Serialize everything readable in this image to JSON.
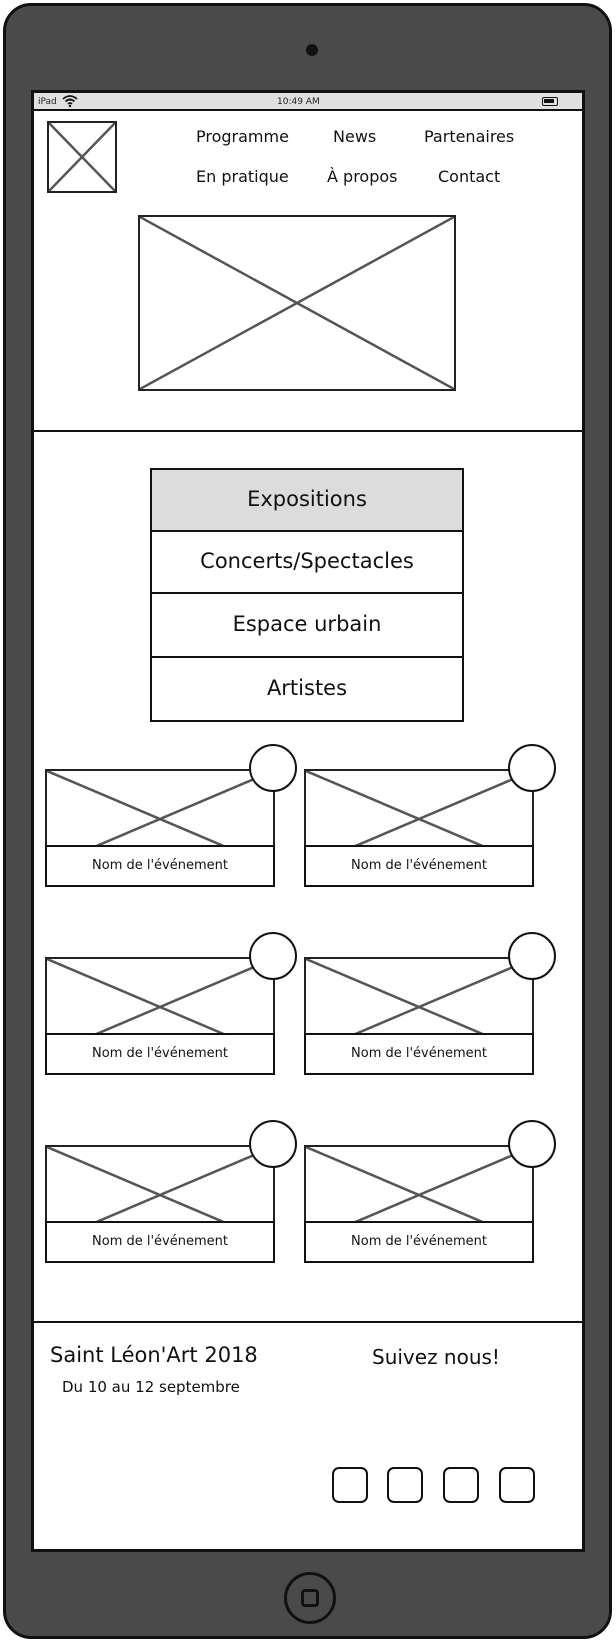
{
  "status_bar": {
    "device": "iPad",
    "time": "10:49 AM",
    "wifi_icon": "wifi-icon",
    "battery_icon": "battery-icon"
  },
  "header": {
    "logo": "image-placeholder",
    "nav": [
      {
        "label": "Programme"
      },
      {
        "label": "News"
      },
      {
        "label": "Partenaires"
      },
      {
        "label": "En pratique"
      },
      {
        "label": "À propos"
      },
      {
        "label": "Contact"
      }
    ],
    "hero": "image-placeholder"
  },
  "categories": {
    "selected": "Expositions",
    "items": [
      {
        "label": "Expositions"
      },
      {
        "label": "Concerts/Spectacles"
      },
      {
        "label": "Espace urbain"
      },
      {
        "label": "Artistes"
      }
    ]
  },
  "events": [
    {
      "name": "Nom de l'événement"
    },
    {
      "name": "Nom de l'événement"
    },
    {
      "name": "Nom de l'événement"
    },
    {
      "name": "Nom de l'événement"
    },
    {
      "name": "Nom de l'événement"
    },
    {
      "name": "Nom de l'événement"
    }
  ],
  "footer": {
    "title": "Saint Léon'Art 2018",
    "dates": "Du 10 au 12 septembre",
    "follow": "Suivez nous!",
    "social_count": 4
  },
  "colors": {
    "device_frame": "#4a4a4a",
    "selected_tab": "#dcdcdc",
    "stroke": "#111111"
  }
}
